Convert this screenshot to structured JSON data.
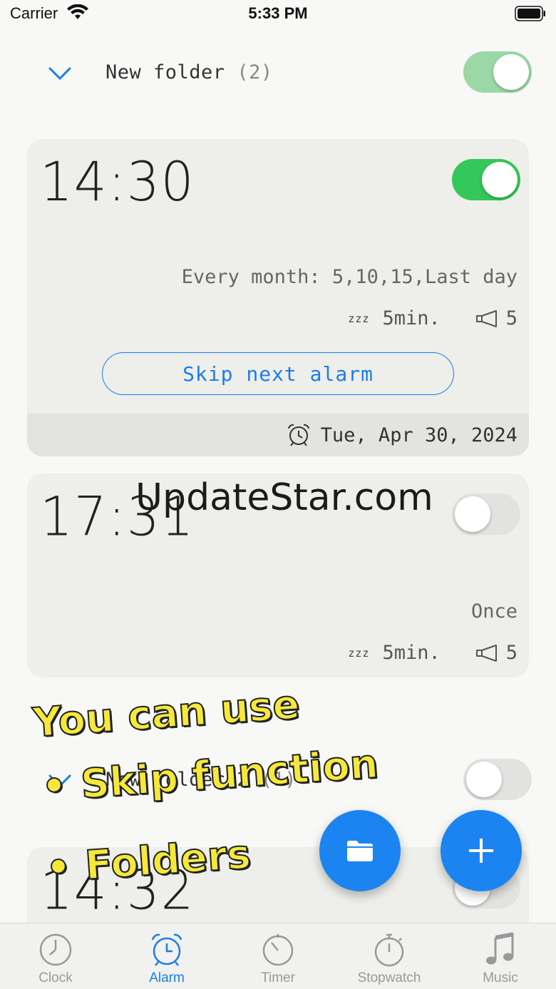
{
  "status_bar": {
    "carrier": "Carrier",
    "time": "5:33 PM"
  },
  "folders": [
    {
      "name": "New folder",
      "count": "(2)",
      "enabled": true
    },
    {
      "name": "New folder 2",
      "count": "(1)",
      "enabled": false
    }
  ],
  "alarms": [
    {
      "time": "14:30",
      "enabled": true,
      "repeat": "Every month: 5,10,15,Last day",
      "snooze": "5min.",
      "volume": "5",
      "skip_label": "Skip next alarm",
      "next_date": "Tue, Apr 30, 2024"
    },
    {
      "time": "17:31",
      "enabled": false,
      "repeat": "Once",
      "snooze": "5min.",
      "volume": "5"
    },
    {
      "time": "14:32",
      "enabled": false
    }
  ],
  "icons": {
    "snooze": "zzz",
    "volume": "megaphone-icon",
    "alarm_clock": "alarm-clock-icon"
  },
  "watermark": "UpdateStar.com",
  "promo": {
    "line1": "You can use",
    "line2": "• Skip function",
    "line3": "• Folders"
  },
  "fabs": {
    "folder": "folder-icon",
    "add": "plus-icon"
  },
  "tabs": [
    {
      "label": "Clock",
      "active": false
    },
    {
      "label": "Alarm",
      "active": true
    },
    {
      "label": "Timer",
      "active": false
    },
    {
      "label": "Stopwatch",
      "active": false
    },
    {
      "label": "Music",
      "active": false
    }
  ],
  "colors": {
    "accent": "#1a7ee8",
    "toggle_on": "#34c759",
    "promo_text": "#f5e83b"
  }
}
